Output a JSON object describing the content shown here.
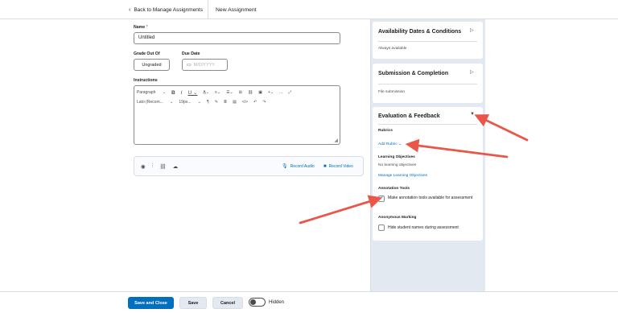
{
  "header": {
    "back_label": "Back to Manage Assignments",
    "page_title": "New Assignment"
  },
  "form": {
    "name_label": "Name",
    "name_required_mark": "*",
    "name_value": "Untitled",
    "grade_label": "Grade Out Of",
    "grade_value": "Ungraded",
    "due_label": "Due Date",
    "due_placeholder": "M/D/YYYY",
    "instructions_label": "Instructions"
  },
  "editor": {
    "paragraph_select": "Paragraph",
    "font_select": "Lato (Recom...",
    "size_select": "19px...",
    "more_label": "..."
  },
  "media": {
    "record_audio": "Record Audio",
    "record_video": "Record Video"
  },
  "sidebar": {
    "availability": {
      "title": "Availability Dates & Conditions",
      "subtitle": "Always available"
    },
    "submission": {
      "title": "Submission & Completion",
      "subtitle": "File submission"
    },
    "evaluation": {
      "title": "Evaluation & Feedback",
      "rubrics_heading": "Rubrics",
      "add_rubric": "Add Rubric",
      "objectives_heading": "Learning Objectives",
      "objectives_text": "No learning objectives",
      "manage_objectives": "Manage Learning Objectives",
      "annotation_heading": "Annotation Tools",
      "annotation_label": "Make annotation tools available for assessment",
      "annotation_checked": true,
      "anon_heading": "Anonymous Marking",
      "anon_label": "Hide student names during assessment",
      "anon_checked": false
    }
  },
  "footer": {
    "save_close": "Save and Close",
    "save": "Save",
    "cancel": "Cancel",
    "visibility": "Hidden"
  },
  "colors": {
    "primary": "#006fbf",
    "annotation_arrow": "#e8574a"
  }
}
